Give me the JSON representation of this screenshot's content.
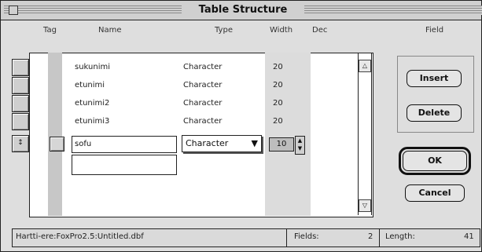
{
  "window": {
    "title": "Table Structure"
  },
  "columns": {
    "tag": "Tag",
    "name": "Name",
    "type": "Type",
    "width": "Width",
    "dec": "Dec",
    "field": "Field"
  },
  "rows": [
    {
      "name": "sukunimi",
      "type": "Character",
      "width": "20"
    },
    {
      "name": "etunimi",
      "type": "Character",
      "width": "20"
    },
    {
      "name": "etunimi2",
      "type": "Character",
      "width": "20"
    },
    {
      "name": "etunimi3",
      "type": "Character",
      "width": "20"
    }
  ],
  "editing_row": {
    "name": "sofu",
    "type": "Character",
    "width": "10"
  },
  "buttons": {
    "insert": "Insert",
    "delete": "Delete",
    "ok": "OK",
    "cancel": "Cancel"
  },
  "status": {
    "path": "Hartti-ere:FoxPro2.5:Untitled.dbf",
    "fields_label": "Fields:",
    "fields_value": "2",
    "length_label": "Length:",
    "length_value": "41"
  }
}
